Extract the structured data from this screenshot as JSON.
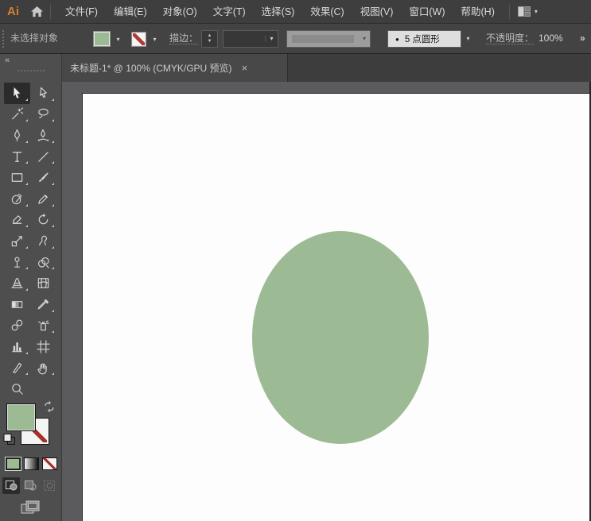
{
  "menubar": {
    "logo": "Ai",
    "items": [
      {
        "label": "文件(F)"
      },
      {
        "label": "编辑(E)"
      },
      {
        "label": "对象(O)"
      },
      {
        "label": "文字(T)"
      },
      {
        "label": "选择(S)"
      },
      {
        "label": "效果(C)"
      },
      {
        "label": "视图(V)"
      },
      {
        "label": "窗口(W)"
      },
      {
        "label": "帮助(H)"
      }
    ]
  },
  "controlbar": {
    "status": "未选择对象",
    "fill_color": "#9cbb95",
    "stroke_color": "none",
    "stroke_label": "描边：",
    "brush_value": "5 点圆形",
    "opacity_label": "不透明度：",
    "opacity_value": "100%"
  },
  "tabbar": {
    "tab_title": "未标题-1* @ 100% (CMYK/GPU 预览)"
  },
  "toolbar": {
    "fill_color": "#9cbb95",
    "tools": [
      {
        "name": "selection-tool",
        "selected": true,
        "flyout": true
      },
      {
        "name": "direct-selection-tool",
        "flyout": true
      },
      {
        "name": "magic-wand-tool",
        "flyout": true
      },
      {
        "name": "lasso-tool",
        "flyout": true
      },
      {
        "name": "pen-tool",
        "flyout": true
      },
      {
        "name": "curvature-tool",
        "flyout": true
      },
      {
        "name": "type-tool",
        "flyout": true
      },
      {
        "name": "line-segment-tool",
        "flyout": true
      },
      {
        "name": "rectangle-tool",
        "flyout": true
      },
      {
        "name": "paintbrush-tool",
        "flyout": true
      },
      {
        "name": "shaper-tool",
        "flyout": true
      },
      {
        "name": "pencil-tool",
        "flyout": true
      },
      {
        "name": "eraser-tool",
        "flyout": true
      },
      {
        "name": "rotate-tool",
        "flyout": true
      },
      {
        "name": "scale-tool",
        "flyout": true
      },
      {
        "name": "puppet-warp-tool",
        "flyout": true
      },
      {
        "name": "free-transform-tool",
        "flyout": true
      },
      {
        "name": "shape-builder-tool",
        "flyout": true
      },
      {
        "name": "perspective-grid-tool",
        "flyout": true
      },
      {
        "name": "mesh-tool",
        "flyout": false
      },
      {
        "name": "gradient-tool",
        "flyout": false
      },
      {
        "name": "eyedropper-tool",
        "flyout": true
      },
      {
        "name": "blend-tool",
        "flyout": false
      },
      {
        "name": "symbol-sprayer-tool",
        "flyout": true
      },
      {
        "name": "column-graph-tool",
        "flyout": true
      },
      {
        "name": "artboard-tool",
        "flyout": false
      },
      {
        "name": "slice-tool",
        "flyout": true
      },
      {
        "name": "hand-tool",
        "flyout": true
      },
      {
        "name": "zoom-tool",
        "flyout": false
      }
    ]
  },
  "canvas": {
    "ellipse_color": "#9cbb95"
  },
  "icons": {
    "chevron_down": "▾",
    "stepper_up": "▲",
    "stepper_down": "▼",
    "collapse": "«",
    "close": "×",
    "bullet": "●",
    "overflow": "»"
  }
}
